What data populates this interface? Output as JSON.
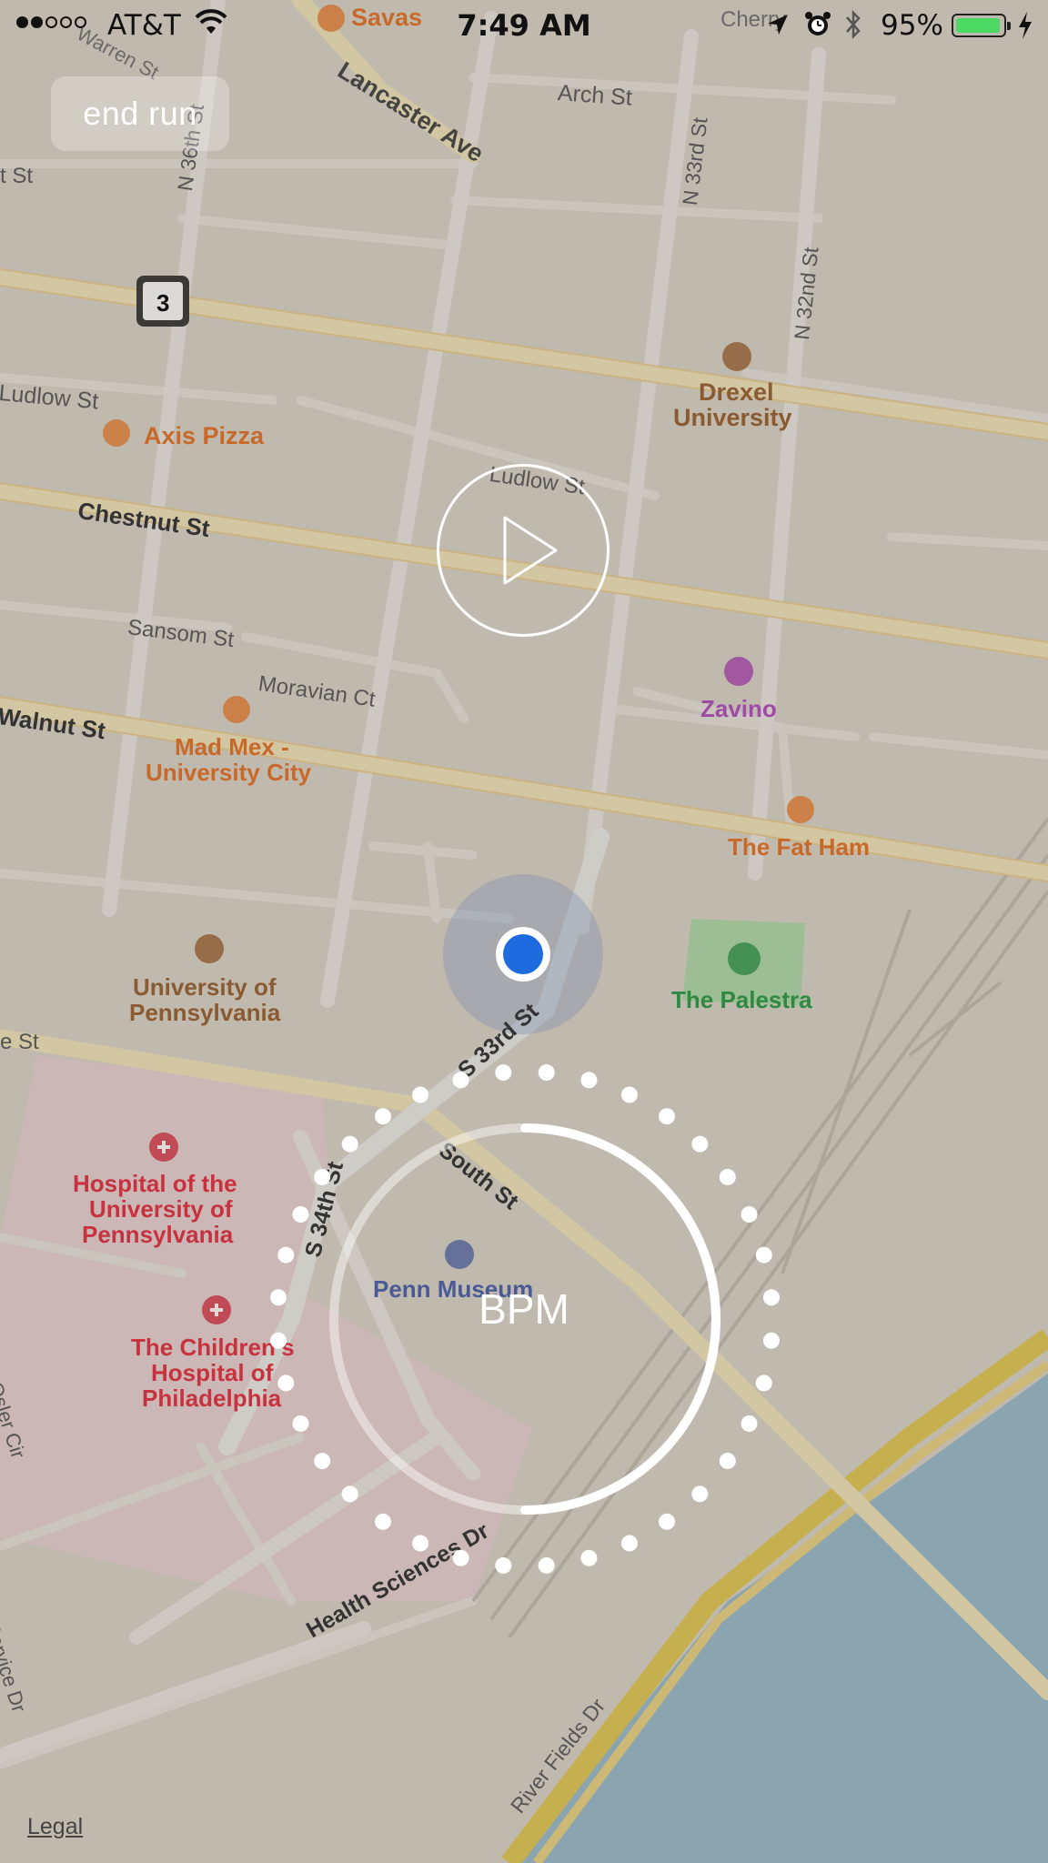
{
  "status_bar": {
    "carrier": "AT&T",
    "time": "7:49 AM",
    "battery_percent": "95%",
    "battery_level": 0.95,
    "signal_bars_filled": 2,
    "signal_bars_total": 5
  },
  "controls": {
    "end_run_label": "end run",
    "bpm_label": "BPM",
    "play_icon": "play-icon",
    "bpm_ring_progress": 0.5,
    "bpm_dot_count": 36
  },
  "map": {
    "legal_label": "Legal",
    "route_badge": "3",
    "streets": {
      "lancaster": "Lancaster Ave",
      "arch": "Arch St",
      "n36": "N 36th St",
      "n33": "N 33rd St",
      "n32": "N 32nd St",
      "ludlow_w": "Ludlow St",
      "ludlow_e": "Ludlow St",
      "chestnut": "Chestnut St",
      "sansom": "Sansom St",
      "moravian": "Moravian Ct",
      "walnut": "Walnut St",
      "s33": "S 33rd St",
      "south": "South St",
      "s34": "S 34th St",
      "health": "Health Sciences Dr",
      "river": "River Fields Dr",
      "osler": "Osler Cir",
      "service": "Service Dr",
      "west_st": "e St",
      "warren": "Warren St",
      "st_left": "t St",
      "cherry": "Cherry"
    },
    "places": {
      "savas": "Savas",
      "axis_pizza": "Axis Pizza",
      "drexel_1": "Drexel",
      "drexel_2": "University",
      "zavino": "Zavino",
      "madmex_1": "Mad Mex -",
      "madmex_2": "University City",
      "fatham": "The Fat Ham",
      "upenn_1": "University of",
      "upenn_2": "Pennsylvania",
      "palestra": "The Palestra",
      "hup_1": "Hospital of the",
      "hup_2": "University of",
      "hup_3": "Pennsylvania",
      "chop_1": "The Children's",
      "chop_2": "Hospital of",
      "chop_3": "Philadelphia",
      "museum": "Penn Museum"
    },
    "colors": {
      "land": "#d9d2c5",
      "road": "#ececea",
      "arterial": "#f2e1b4",
      "water": "#8fb6c9",
      "hospital": "#e8cfd0",
      "park": "#a8d8a3",
      "food": "#e8843a",
      "school": "#a0673a",
      "medical": "#d83a4e",
      "bar": "#b04ab5",
      "location": "#1e6be0",
      "dim_overlay": "rgba(128,122,112,0.28)"
    }
  }
}
